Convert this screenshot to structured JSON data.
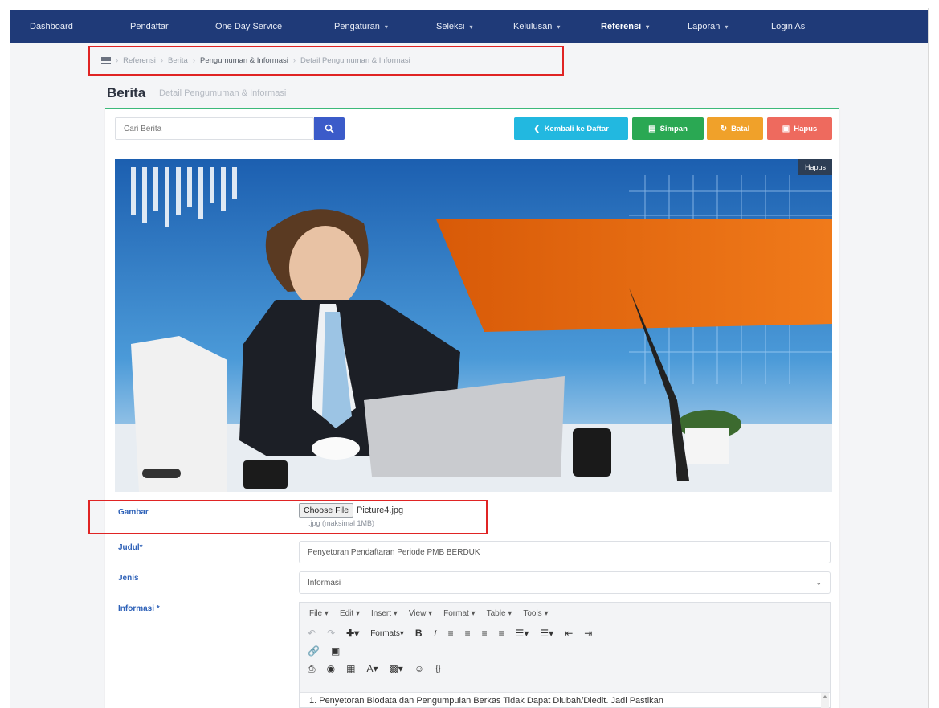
{
  "nav": {
    "items": [
      {
        "label": "Dashboard",
        "dropdown": false,
        "active": false
      },
      {
        "label": "Pendaftar",
        "dropdown": false,
        "active": false
      },
      {
        "label": "One Day Service",
        "dropdown": false,
        "active": false
      },
      {
        "label": "Pengaturan",
        "dropdown": true,
        "active": false
      },
      {
        "label": "Seleksi",
        "dropdown": true,
        "active": false
      },
      {
        "label": "Kelulusan",
        "dropdown": true,
        "active": false
      },
      {
        "label": "Referensi",
        "dropdown": true,
        "active": true
      },
      {
        "label": "Laporan",
        "dropdown": true,
        "active": false
      },
      {
        "label": "Login As",
        "dropdown": false,
        "active": false
      }
    ],
    "color": "#1f3a78"
  },
  "breadcrumb": {
    "home_icon": "menu-icon",
    "items": [
      "Referensi",
      "Berita",
      "Pengumuman & Informasi",
      "Detail Pengumuman & Informasi"
    ]
  },
  "page": {
    "title": "Berita",
    "subtitle": "Detail Pengumuman & Informasi"
  },
  "toolbar": {
    "search_placeholder": "Cari Berita",
    "search_icon": "search-icon",
    "back_label": "Kembali ke Daftar",
    "save_label": "Simpan",
    "reset_label": "Batal",
    "delete_label": "Hapus",
    "colors": {
      "back": "#22b8e0",
      "save": "#2aa853",
      "reset": "#f0a12a",
      "delete": "#ee6a5e",
      "search": "#3b5bc9"
    }
  },
  "image": {
    "delete_label": "Hapus"
  },
  "form": {
    "gambar_label": "Gambar",
    "choose_file_label": "Choose File",
    "file_name": "Picture4.jpg",
    "file_hint": ".jpg (maksimal 1MB)",
    "judul_label": "Judul*",
    "judul_value": "Penyetoran Pendaftaran Periode PMB BERDUK",
    "jenis_label": "Jenis",
    "jenis_value": "Informasi",
    "informasi_label": "Informasi *"
  },
  "editor": {
    "menus": [
      "File",
      "Edit",
      "Insert",
      "View",
      "Format",
      "Table",
      "Tools"
    ],
    "formats_label": "Formats",
    "content_line": "1. Penyetoran Biodata dan Pengumpulan Berkas Tidak Dapat Diubah/Diedit. Jadi Pastikan"
  }
}
